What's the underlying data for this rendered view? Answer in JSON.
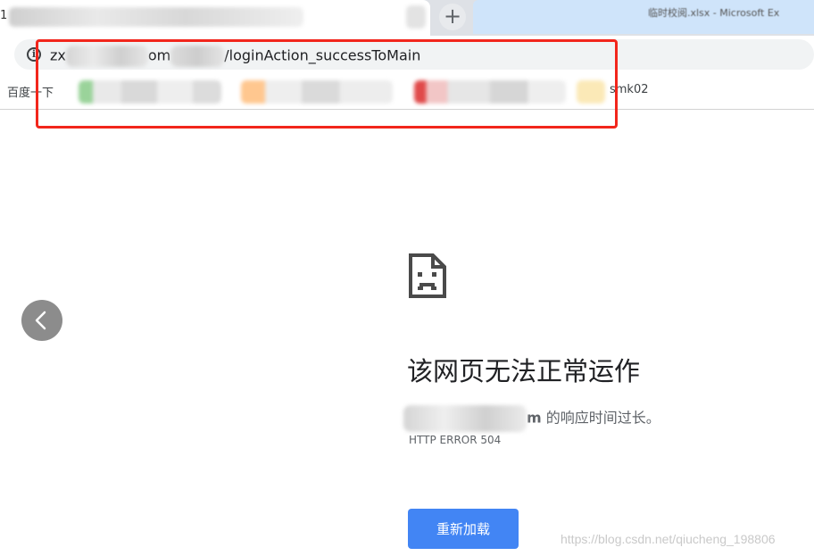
{
  "tab": {
    "active_title_fragment": "1",
    "new_tab_icon": "plus-icon",
    "inactive_title": "临时校阅.xlsx - Microsoft Ex"
  },
  "omnibox": {
    "info_icon": "info-icon",
    "url_prefix": "zx",
    "url_mid": "om",
    "url_path": "/loginAction_successToMain"
  },
  "bookmarks": {
    "baidu": "百度一下",
    "smk": "smk02"
  },
  "error": {
    "icon": "sad-page-icon",
    "title": "该网页无法正常运作",
    "host_suffix": "m",
    "message": " 的响应时间过长。",
    "code": "HTTP ERROR 504",
    "reload_label": "重新加载"
  },
  "nav": {
    "back_icon": "chevron-left-icon"
  },
  "watermark": "https://blog.csdn.net/qiucheng_198806",
  "colors": {
    "annotation": "#f2261c",
    "button": "#4285f4"
  }
}
